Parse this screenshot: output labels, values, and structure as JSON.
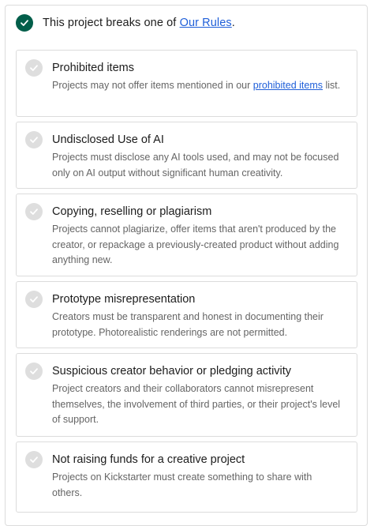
{
  "header": {
    "text_before": "This project breaks one of ",
    "link": "Our Rules",
    "text_after": "."
  },
  "rules": [
    {
      "title": "Prohibited items",
      "desc_before": "Projects may not offer items mentioned in our ",
      "desc_link": "prohibited items",
      "desc_after": " list."
    },
    {
      "title": "Undisclosed Use of AI",
      "desc": "Projects must disclose any AI tools used, and may not be focused only on AI output without significant human creativity."
    },
    {
      "title": "Copying, reselling or plagiarism",
      "desc": "Projects cannot plagiarize, offer items that aren't produced by the creator, or repackage a previously-created product without adding anything new."
    },
    {
      "title": "Prototype misrepresentation",
      "desc": "Creators must be transparent and honest in documenting their prototype. Photorealistic renderings are not permitted."
    },
    {
      "title": "Suspicious creator behavior or pledging activity",
      "desc": "Project creators and their collaborators cannot misrepresent themselves, the involvement of third parties, or their project's level of support."
    },
    {
      "title": "Not raising funds for a creative project",
      "desc": "Projects on Kickstarter must create something to share with others."
    }
  ],
  "colors": {
    "accent_check": "#025e4a",
    "link": "#1f5fd9",
    "muted_check": "#dedede"
  }
}
